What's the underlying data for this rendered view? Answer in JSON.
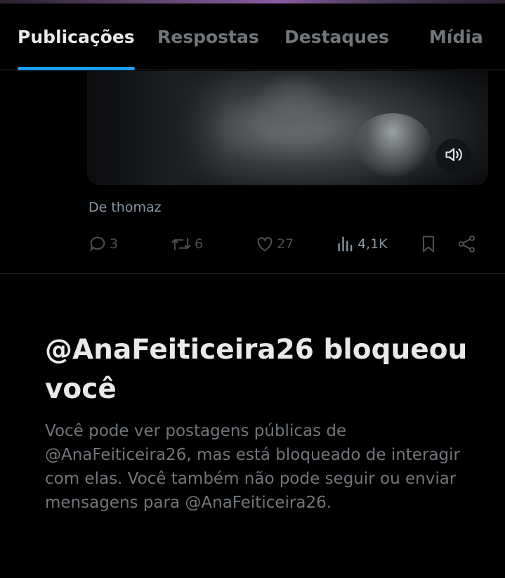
{
  "tabs": [
    {
      "label": "Publicações",
      "active": true
    },
    {
      "label": "Respostas",
      "active": false
    },
    {
      "label": "Destaques",
      "active": false
    },
    {
      "label": "Mídia",
      "active": false
    }
  ],
  "post": {
    "caption": "De thomaz",
    "actions": {
      "replies": "3",
      "reposts": "6",
      "likes": "27",
      "views": "4,1K"
    },
    "media_control_icon": "speaker-icon"
  },
  "blocked": {
    "title": "@AnaFeiticeira26 bloqueou você",
    "description": "Você pode ver postagens públicas de @AnaFeiticeira26, mas está bloqueado de interagir com elas. Você também não pode seguir ou enviar mensagens para @AnaFeiticeira26."
  },
  "colors": {
    "accent": "#1d9bf0",
    "background": "#000000",
    "text_primary": "#e7e9ea",
    "text_secondary": "#71767b"
  }
}
